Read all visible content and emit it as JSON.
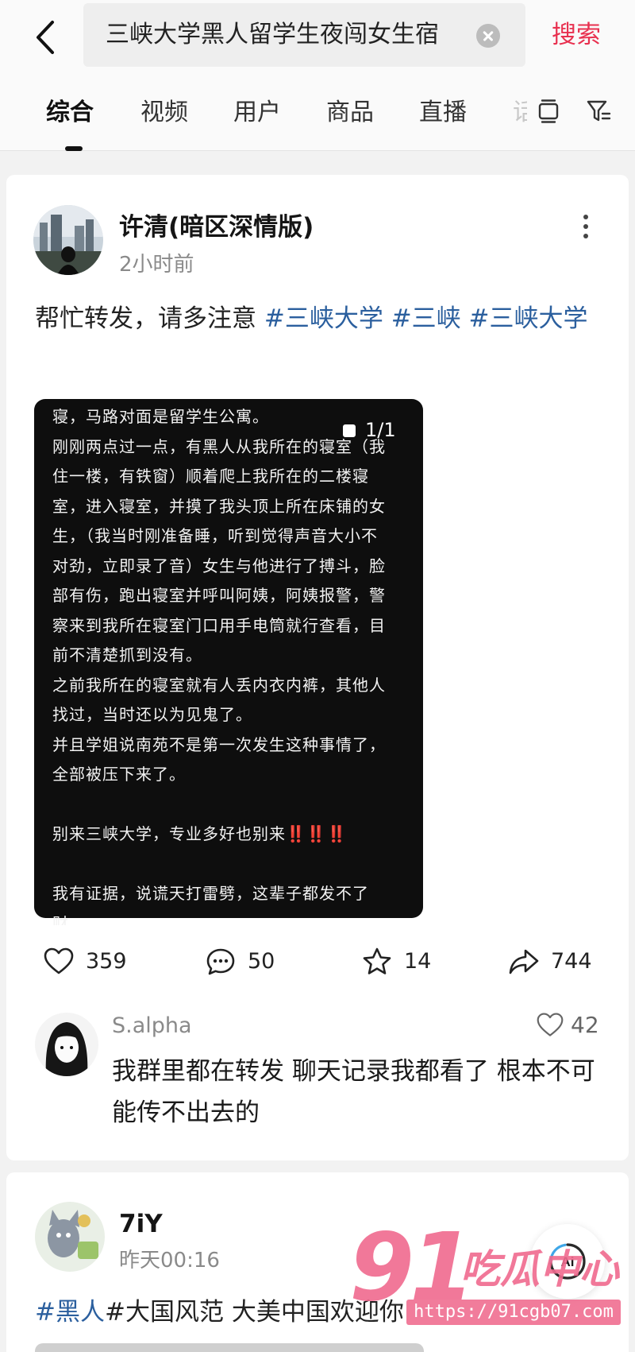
{
  "search": {
    "query": "三峡大学黑人留学生夜闯女生宿",
    "submit_label": "搜索"
  },
  "tabs": [
    {
      "label": "综合",
      "active": true
    },
    {
      "label": "视频",
      "active": false
    },
    {
      "label": "用户",
      "active": false
    },
    {
      "label": "商品",
      "active": false
    },
    {
      "label": "直播",
      "active": false
    }
  ],
  "tab_partial": "话",
  "post1": {
    "author": "许清(暗区深情版)",
    "time": "2小时前",
    "text_plain": "帮忙转发，请多注意 ",
    "tags": [
      "#三峡大学",
      "#三峡",
      "#三峡大学"
    ],
    "image": {
      "counter": "1/1",
      "lines": [
        "寝，马路对面是留学生公寓。",
        "刚刚两点过一点，有黑人从我所在的寝室（我",
        "住一楼，有铁窗）顺着爬上我所在的二楼寝",
        "室，进入寝室，并摸了我头顶上所在床铺的女",
        "生，（我当时刚准备睡，听到觉得声音大小不",
        "对劲，立即录了音）女生与他进行了搏斗，脸",
        "部有伤，跑出寝室并呼叫阿姨，阿姨报警，警",
        "察来到我所在寝室门口用手电筒就行查看，目",
        "前不清楚抓到没有。",
        "之前我所在的寝室就有人丢内衣内裤，其他人",
        "找过，当时还以为见鬼了。",
        "并且学姐说南苑不是第一次发生这种事情了，",
        "全部被压下来了。",
        "",
        "别来三峡大学，专业多好也别来",
        "",
        "我有证据，说谎天打雷劈，这辈子都发不了",
        "财。"
      ],
      "exclaim": "‼️‼️‼️"
    },
    "likes": "359",
    "comments": "50",
    "favorites": "14",
    "shares": "744",
    "top_comment": {
      "author": "S.alpha",
      "likes": "42",
      "text": "我群里都在转发 聊天记录我都看了 根本不可能传不出去的"
    }
  },
  "post2": {
    "author": "7iY",
    "time": "昨天00:16",
    "tags": [
      "#黑人",
      "#大国风范"
    ],
    "text": " 大美中国欢迎你"
  },
  "ai_button": {
    "label": "Ai"
  },
  "watermark": {
    "number": "91",
    "text": "吃瓜中心",
    "url": "https://91cgb07.com"
  },
  "colors": {
    "accent": "#e8304f",
    "tag": "#2b5f9e",
    "watermark": "#f06a8e"
  }
}
